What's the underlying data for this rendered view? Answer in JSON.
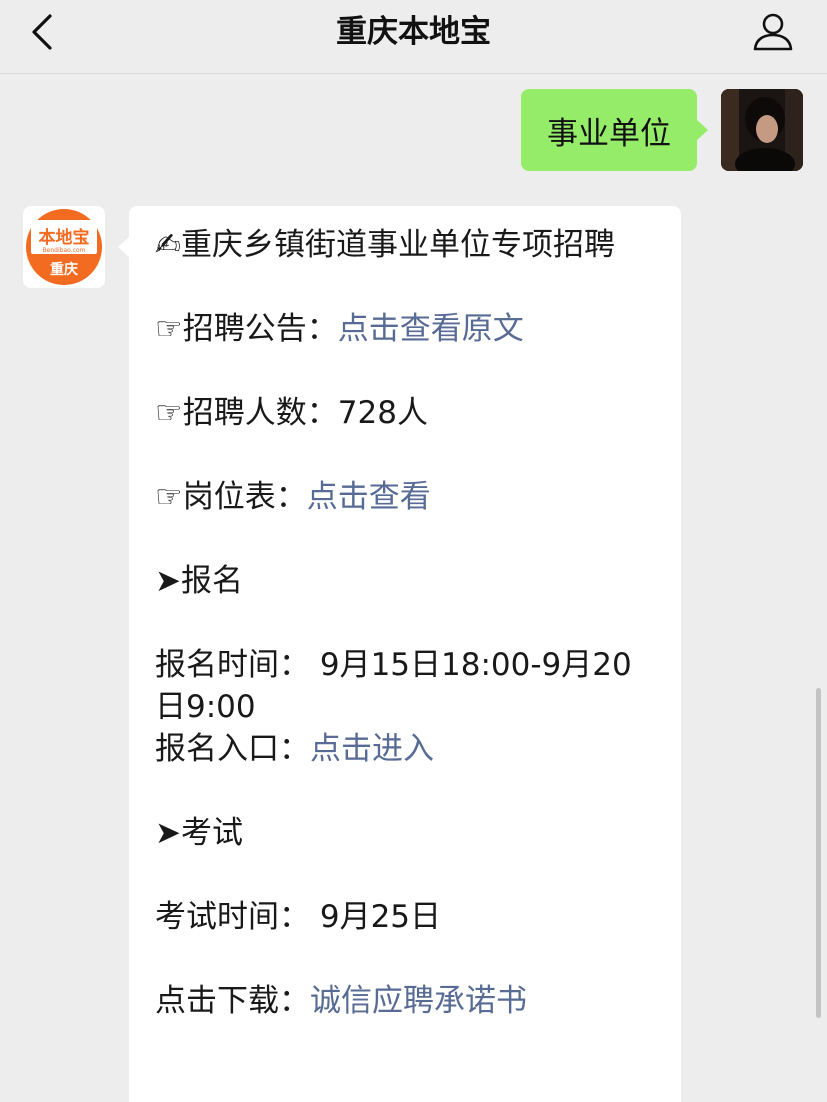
{
  "header": {
    "title": "重庆本地宝",
    "back_icon": "chevron-left-icon",
    "profile_icon": "person-icon"
  },
  "outgoing_message": {
    "text": "事业单位",
    "bubble_color": "#95ec69"
  },
  "bot_avatar": {
    "logo_text_top": "本地宝",
    "logo_text_url": "Bendibao.com",
    "logo_text_city": "重庆",
    "brand_color": "#f26b21"
  },
  "incoming_message": {
    "title_emoji": "✍",
    "title": "重庆乡镇街道事业单位专项招聘",
    "announcement_prefix": "☞招聘公告：",
    "announcement_link": "点击查看原文",
    "headcount_text": "☞招聘人数：728人",
    "positions_prefix": "☞岗位表：",
    "positions_link": "点击查看",
    "section_signup": "➤报名",
    "signup_time": "报名时间： 9月15日18:00-9月20日9:00",
    "signup_entry_prefix": "报名入口：",
    "signup_entry_link": "点击进入",
    "section_exam": "➤考试",
    "exam_time": "考试时间： 9月25日",
    "download_prefix": "点击下载：",
    "download_link": "诚信应聘承诺书",
    "link_color": "#576b95"
  }
}
